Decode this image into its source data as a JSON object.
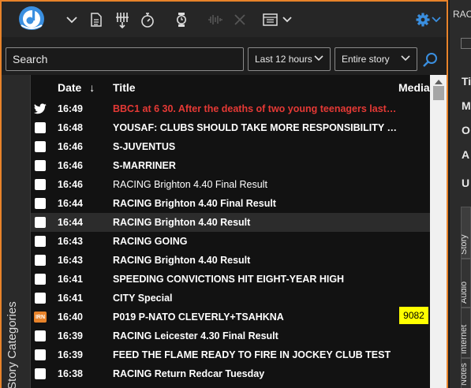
{
  "search": {
    "placeholder": "Search",
    "time_filter": "Last 12 hours",
    "scope_filter": "Entire story"
  },
  "sidebar": {
    "label": "Story Categories"
  },
  "columns": {
    "date": "Date",
    "sort_arrow": "↓",
    "title": "Title",
    "media": "Media"
  },
  "rows": [
    {
      "icon": "twitter",
      "time": "16:49",
      "title": "BBC1 at 6 30. After the deaths of two young teenagers last we…",
      "style": "red"
    },
    {
      "icon": "checkbox",
      "time": "16:48",
      "title": "YOUSAF: CLUBS SHOULD TAKE MORE RESPONSIBILITY FOR F…",
      "style": "bold"
    },
    {
      "icon": "checkbox",
      "time": "16:46",
      "title": "S-JUVENTUS",
      "style": "bold"
    },
    {
      "icon": "checkbox",
      "time": "16:46",
      "title": "S-MARRINER",
      "style": "bold"
    },
    {
      "icon": "checkbox",
      "time": "16:46",
      "title": "RACING Brighton 4.40 Final Result",
      "style": "normal"
    },
    {
      "icon": "checkbox",
      "time": "16:44",
      "title": "RACING Brighton 4.40 Final Result",
      "style": "bold"
    },
    {
      "icon": "checkbox",
      "time": "16:44",
      "title": "RACING Brighton 4.40 Result",
      "style": "bold",
      "selected": true
    },
    {
      "icon": "checkbox",
      "time": "16:43",
      "title": "RACING GOING",
      "style": "bold"
    },
    {
      "icon": "checkbox",
      "time": "16:43",
      "title": "RACING Brighton 4.40 Result",
      "style": "bold"
    },
    {
      "icon": "checkbox",
      "time": "16:41",
      "title": "SPEEDING CONVICTIONS HIT EIGHT-YEAR HIGH",
      "style": "bold"
    },
    {
      "icon": "checkbox",
      "time": "16:41",
      "title": "CITY Special",
      "style": "bold"
    },
    {
      "icon": "irn",
      "icon_label": "IRN",
      "time": "16:40",
      "title": "P019 P-NATO CLEVERLY+TSAHKNA",
      "style": "bold",
      "media": "9082"
    },
    {
      "icon": "checkbox",
      "time": "16:39",
      "title": "RACING Leicester 4.30 Final Result",
      "style": "bold"
    },
    {
      "icon": "checkbox",
      "time": "16:39",
      "title": "FEED THE FLAME READY TO FIRE IN JOCKEY CLUB TEST",
      "style": "bold"
    },
    {
      "icon": "checkbox",
      "time": "16:38",
      "title": "RACING Return Redcar Tuesday",
      "style": "bold"
    }
  ],
  "right_panel": {
    "heading": "RAC",
    "labels": [
      "Ti",
      "M",
      "O",
      "A",
      "U"
    ],
    "tabs": [
      "Story",
      "Audio",
      "Internet",
      "Notes"
    ]
  },
  "colors": {
    "accent": "#e8832a",
    "link_blue": "#3a8fe0",
    "headline_red": "#e53935",
    "media_badge": "#ffff00",
    "irn_badge": "#e8832a"
  }
}
